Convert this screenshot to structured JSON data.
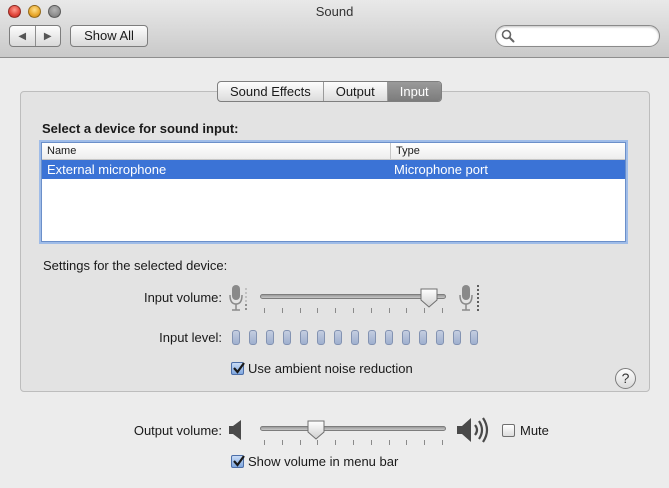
{
  "window": {
    "title": "Sound",
    "show_all_label": "Show All",
    "search_placeholder": "",
    "back_glyph": "◀",
    "forward_glyph": "▶"
  },
  "tabs": [
    {
      "label": "Sound Effects",
      "active": false
    },
    {
      "label": "Output",
      "active": false
    },
    {
      "label": "Input",
      "active": true
    }
  ],
  "input_panel": {
    "heading": "Select a device for sound input:",
    "columns": [
      "Name",
      "Type"
    ],
    "devices": [
      {
        "name": "External microphone",
        "type": "Microphone port",
        "selected": true
      }
    ],
    "settings_heading": "Settings for the selected device:",
    "input_volume_label": "Input volume:",
    "input_volume_value": 0.92,
    "input_level_label": "Input level:",
    "input_level_segments": 15,
    "input_level_lit": 0,
    "ambient_noise_label": "Use ambient noise reduction",
    "ambient_noise_checked": true,
    "help_label": "?"
  },
  "output_section": {
    "output_volume_label": "Output volume:",
    "output_volume_value": 0.27,
    "mute_label": "Mute",
    "mute_checked": false,
    "show_volume_label": "Show volume in menu bar",
    "show_volume_checked": true
  },
  "icons": {
    "mic_low": "microphone-low-icon",
    "mic_high": "microphone-high-icon",
    "speaker_low": "speaker-low-icon",
    "speaker_high": "speaker-high-icon",
    "search": "search-icon"
  },
  "colors": {
    "selection": "#3b73d6",
    "focus_ring": "#9fbce8",
    "level_segment": "#aebad4"
  }
}
